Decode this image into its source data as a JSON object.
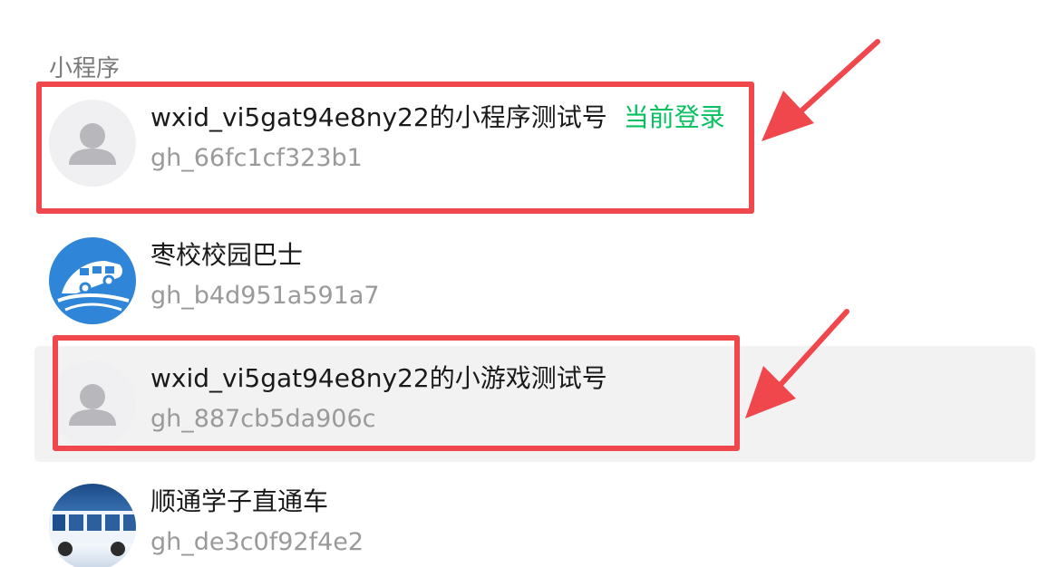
{
  "section": {
    "title": "小程序"
  },
  "accounts": [
    {
      "name": "wxid_vi5gat94e8ny22的小程序测试号",
      "tag": "当前登录",
      "appid": "gh_66fc1cf323b1",
      "avatar": "default-user-icon"
    },
    {
      "name": "枣校校园巴士",
      "tag": "",
      "appid": "gh_b4d951a591a7",
      "avatar": "bus-logo"
    },
    {
      "name": "wxid_vi5gat94e8ny22的小游戏测试号",
      "tag": "",
      "appid": "gh_887cb5da906c",
      "avatar": "default-user-icon"
    },
    {
      "name": "顺通学子直通车",
      "tag": "",
      "appid": "gh_de3c0f92f4e2",
      "avatar": "bus-photo"
    }
  ],
  "colors": {
    "highlight": "#f0474d",
    "current_tag": "#07c160",
    "hover_row": "#f2f2f2"
  }
}
